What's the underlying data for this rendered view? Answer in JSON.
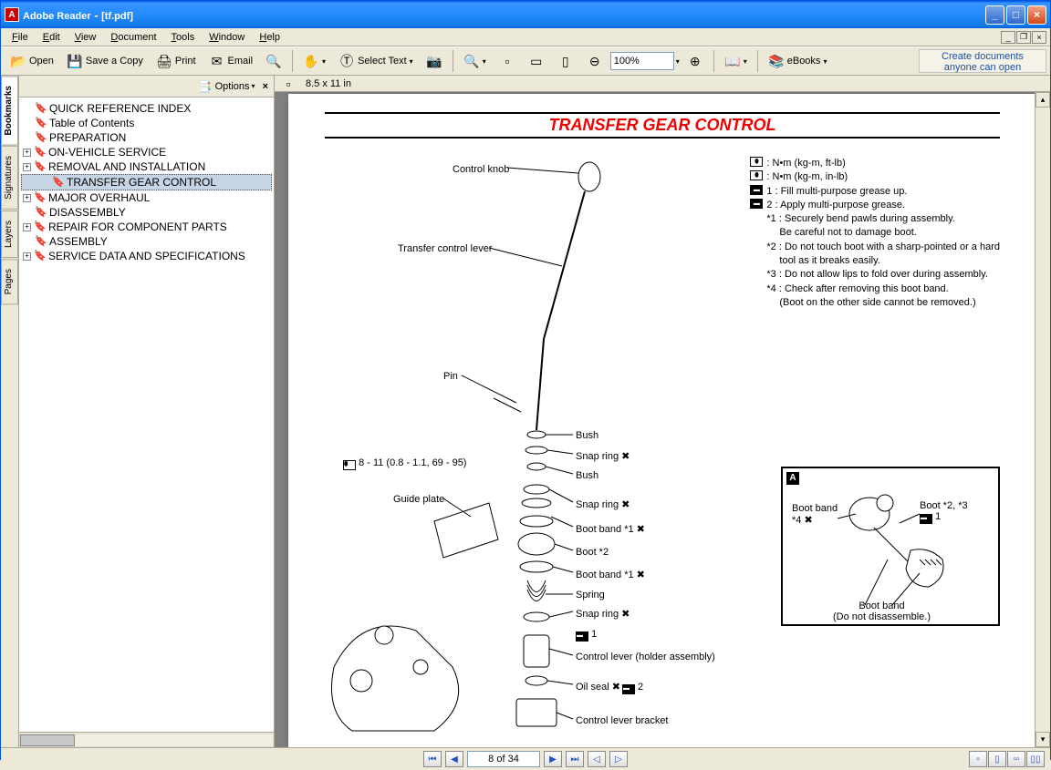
{
  "titlebar": {
    "app": "Adobe Reader",
    "doc": "[tf.pdf]"
  },
  "menu": {
    "file": "File",
    "edit": "Edit",
    "view": "View",
    "document": "Document",
    "tools": "Tools",
    "window": "Window",
    "help": "Help"
  },
  "toolbar": {
    "open": "Open",
    "save": "Save a Copy",
    "print": "Print",
    "email": "Email",
    "selecttext": "Select Text",
    "zoom": "100%",
    "ebooks": "eBooks",
    "ad_l1": "Create documents",
    "ad_l2": "anyone can open"
  },
  "vtabs": {
    "bookmarks": "Bookmarks",
    "signatures": "Signatures",
    "layers": "Layers",
    "pages": "Pages"
  },
  "sidebar": {
    "options": "Options"
  },
  "bookmarks": [
    {
      "exp": false,
      "t": "QUICK REFERENCE INDEX"
    },
    {
      "exp": false,
      "t": "Table of Contents"
    },
    {
      "exp": false,
      "t": "PREPARATION"
    },
    {
      "exp": true,
      "t": "ON-VEHICLE SERVICE"
    },
    {
      "exp": true,
      "t": "REMOVAL AND INSTALLATION"
    },
    {
      "exp": false,
      "t": "TRANSFER GEAR CONTROL",
      "sel": true,
      "indent": true
    },
    {
      "exp": true,
      "t": "MAJOR OVERHAUL"
    },
    {
      "exp": false,
      "t": "DISASSEMBLY"
    },
    {
      "exp": true,
      "t": "REPAIR FOR COMPONENT PARTS"
    },
    {
      "exp": false,
      "t": "ASSEMBLY"
    },
    {
      "exp": true,
      "t": "SERVICE DATA AND SPECIFICATIONS"
    }
  ],
  "docbar": {
    "dim": "8.5 x 11 in"
  },
  "page": {
    "title": "TRANSFER GEAR CONTROL",
    "labels": {
      "control_knob": "Control knob",
      "transfer_lever": "Transfer control lever",
      "pin": "Pin",
      "torque": "8 - 11 (0.8 - 1.1, 69 - 95)",
      "guide_plate": "Guide plate",
      "bush1": "Bush",
      "snap1": "Snap ring",
      "bush2": "Bush",
      "snap2": "Snap ring",
      "bootband1": "Boot band *1",
      "boot2": "Boot *2",
      "bootband1b": "Boot band *1",
      "spring": "Spring",
      "snap3": "Snap ring",
      "note1": "1",
      "ctrl_lever": "Control lever (holder assembly)",
      "oilseal": "Oil seal",
      "note2": "2",
      "bracket": "Control lever bracket"
    },
    "legend": {
      "l1": "N•m  (kg-m,  ft-lb)",
      "l2": "N•m  (kg-m,  in-lb)",
      "l3": "1 : Fill multi-purpose grease up.",
      "l4": "2 : Apply multi-purpose grease.",
      "n1": "*1 : Securely bend pawls during assembly.",
      "n1b": "Be careful not to damage boot.",
      "n2": "*2 : Do not touch boot with a sharp-pointed or a hard",
      "n2b": "tool as it breaks easily.",
      "n3": "*3 : Do not allow lips to fold over during assembly.",
      "n4": "*4 : Check after removing this boot band.",
      "n4b": "(Boot on the other side cannot be removed.)"
    },
    "inset": {
      "tag": "A",
      "boot_band1": "Boot band",
      "star4": "*4",
      "boot23": "Boot *2, *3",
      "one": "1",
      "boot_band2": "Boot band",
      "nodis": "(Do not disassemble.)"
    }
  },
  "status": {
    "page": "8 of 34"
  }
}
